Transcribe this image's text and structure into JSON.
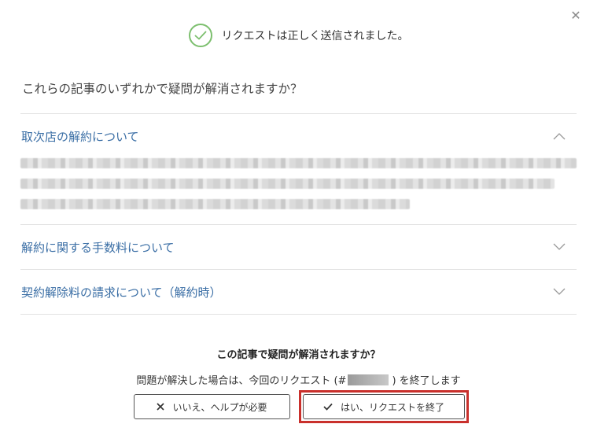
{
  "dialog": {
    "close_label": "✕",
    "success_message": "リクエストは正しく送信されました。",
    "question": "これらの記事のいずれかで疑問が解消されますか？"
  },
  "articles": [
    {
      "title": "取次店の解約について",
      "expanded": true
    },
    {
      "title": "解約に関する手数料について",
      "expanded": false
    },
    {
      "title": "契約解除料の請求について（解約時）",
      "expanded": false
    }
  ],
  "confirm": {
    "title": "この記事で疑問が解消されますか？",
    "sub_prefix": "問題が解決した場合は、今回のリクエスト (#",
    "sub_suffix": ") を終了します"
  },
  "buttons": {
    "no_label": "いいえ、ヘルプが必要",
    "yes_label": "はい、リクエストを終了"
  },
  "colors": {
    "success": "#7cbf6e",
    "link": "#3a6ea5",
    "highlight": "#c9302c"
  }
}
